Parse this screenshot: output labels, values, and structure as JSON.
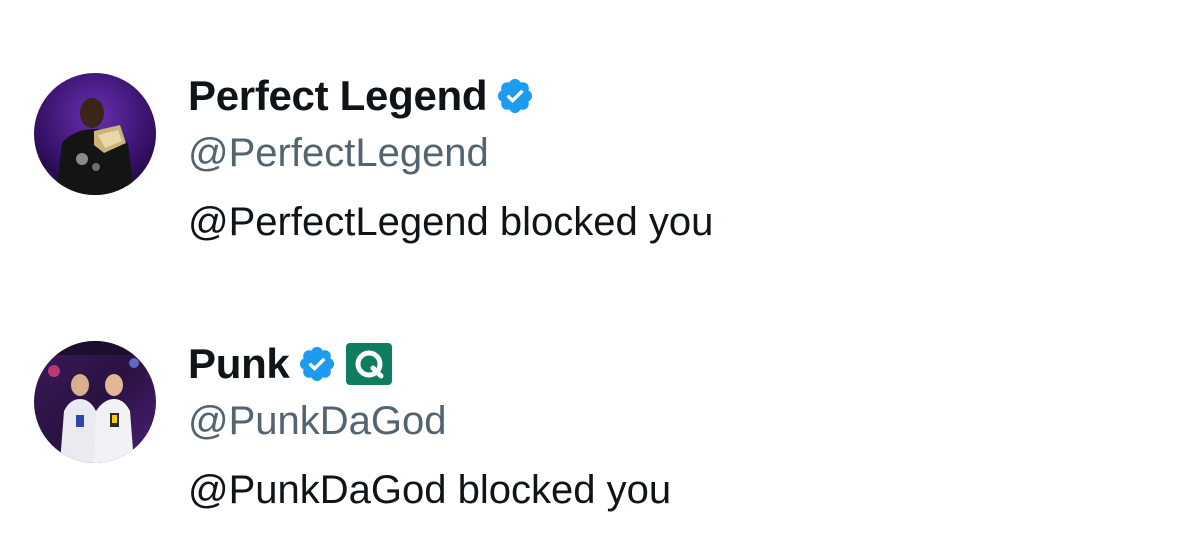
{
  "entries": [
    {
      "display_name": "Perfect Legend",
      "handle": "@PerfectLegend",
      "status": "@PerfectLegend blocked you",
      "verified_icon": "verified-badge-icon",
      "avatar_icon": "avatar-photo"
    },
    {
      "display_name": "Punk",
      "handle": "@PunkDaGod",
      "status": "@PunkDaGod blocked you",
      "verified_icon": "verified-badge-icon",
      "affiliation_icon": "affiliate-badge-icon",
      "avatar_icon": "avatar-photo"
    }
  ],
  "colors": {
    "name_text": "#0f1419",
    "handle_text": "#536471",
    "verified_blue": "#1d9bf0",
    "affiliate_green": "#0f7d5f"
  }
}
